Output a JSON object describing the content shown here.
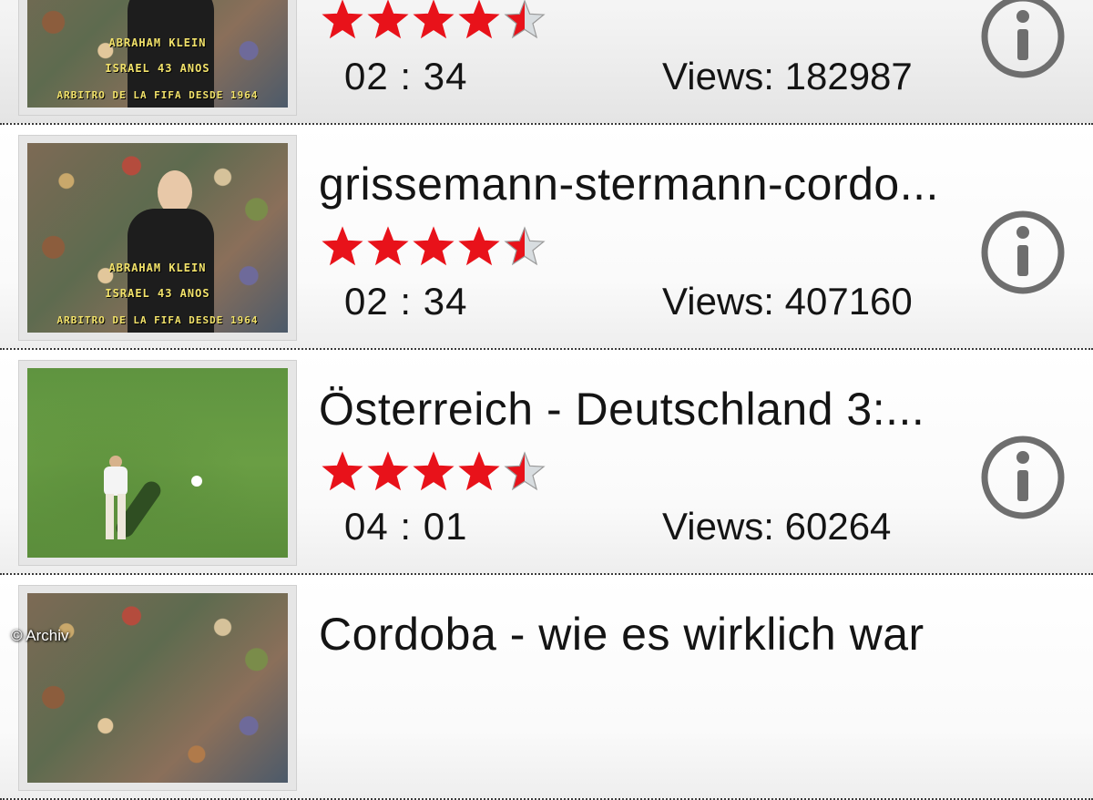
{
  "videos": [
    {
      "title": "",
      "rating": 4.5,
      "duration": "02 : 34",
      "views": "Views: 182987",
      "thumbnail": "referee-crowd",
      "thumb_caption": [
        "ABRAHAM KLEIN",
        "ISRAEL     43 ANOS",
        "ARBITRO DE LA FIFA DESDE 1964"
      ]
    },
    {
      "title": "grissemann-stermann-cordo...",
      "rating": 4.5,
      "duration": "02 : 34",
      "views": "Views: 407160",
      "thumbnail": "referee-crowd",
      "thumb_caption": [
        "ABRAHAM KLEIN",
        "ISRAEL     43 ANOS",
        "ARBITRO DE LA FIFA DESDE 1964"
      ]
    },
    {
      "title": "Österreich - Deutschland 3:...",
      "rating": 4.5,
      "duration": "04 : 01",
      "views": "Views: 60264",
      "thumbnail": "football-pitch"
    },
    {
      "title": "Cordoba - wie es wirklich war",
      "thumbnail": "crowd"
    }
  ],
  "colors": {
    "star_fill": "#e8121a",
    "star_empty": "#d8dde0",
    "info_icon": "#6e6e6e",
    "divider": "#3a3a3a"
  },
  "icons": {
    "rating": "star-icon",
    "info": "info-icon"
  },
  "credit": "© Archiv"
}
